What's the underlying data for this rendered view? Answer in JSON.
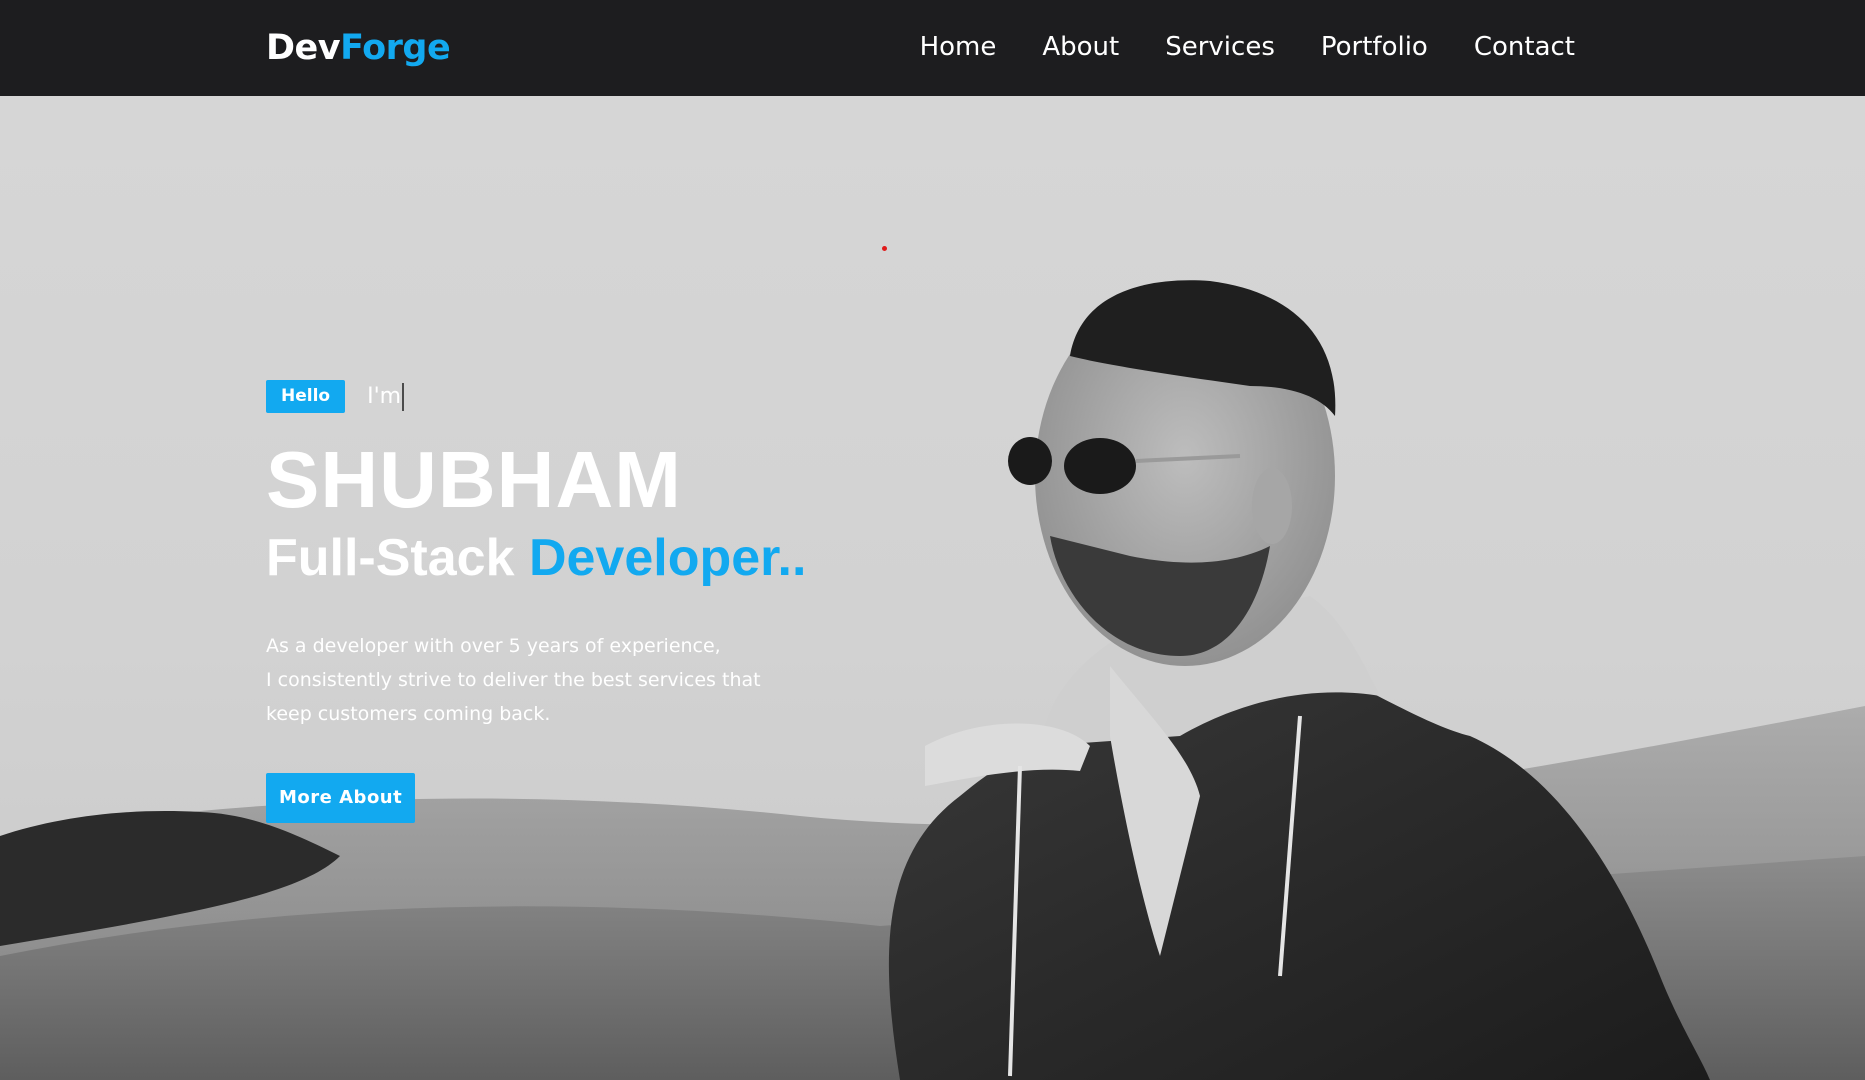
{
  "navbar": {
    "brand_part1": "Dev",
    "brand_part2": "Forge",
    "links": [
      {
        "label": "Home"
      },
      {
        "label": "About"
      },
      {
        "label": "Services"
      },
      {
        "label": "Portfolio"
      },
      {
        "label": "Contact"
      }
    ]
  },
  "hero": {
    "badge": "Hello",
    "typed_text": "I'm",
    "name": "SHUBHAM",
    "role_part1": "Full-Stack ",
    "role_part2": "Developer..",
    "description_lines": [
      "As a developer with over 5 years of experience,",
      "I consistently strive to deliver the best services that",
      "keep customers coming back."
    ],
    "button_label": "More About",
    "portrait_icon": "person-photo-icon"
  },
  "colors": {
    "accent": "#12a9f0",
    "navbar_bg": "#1d1d1f",
    "hero_bg": "#d3d3d3",
    "text_light": "#ffffff"
  }
}
